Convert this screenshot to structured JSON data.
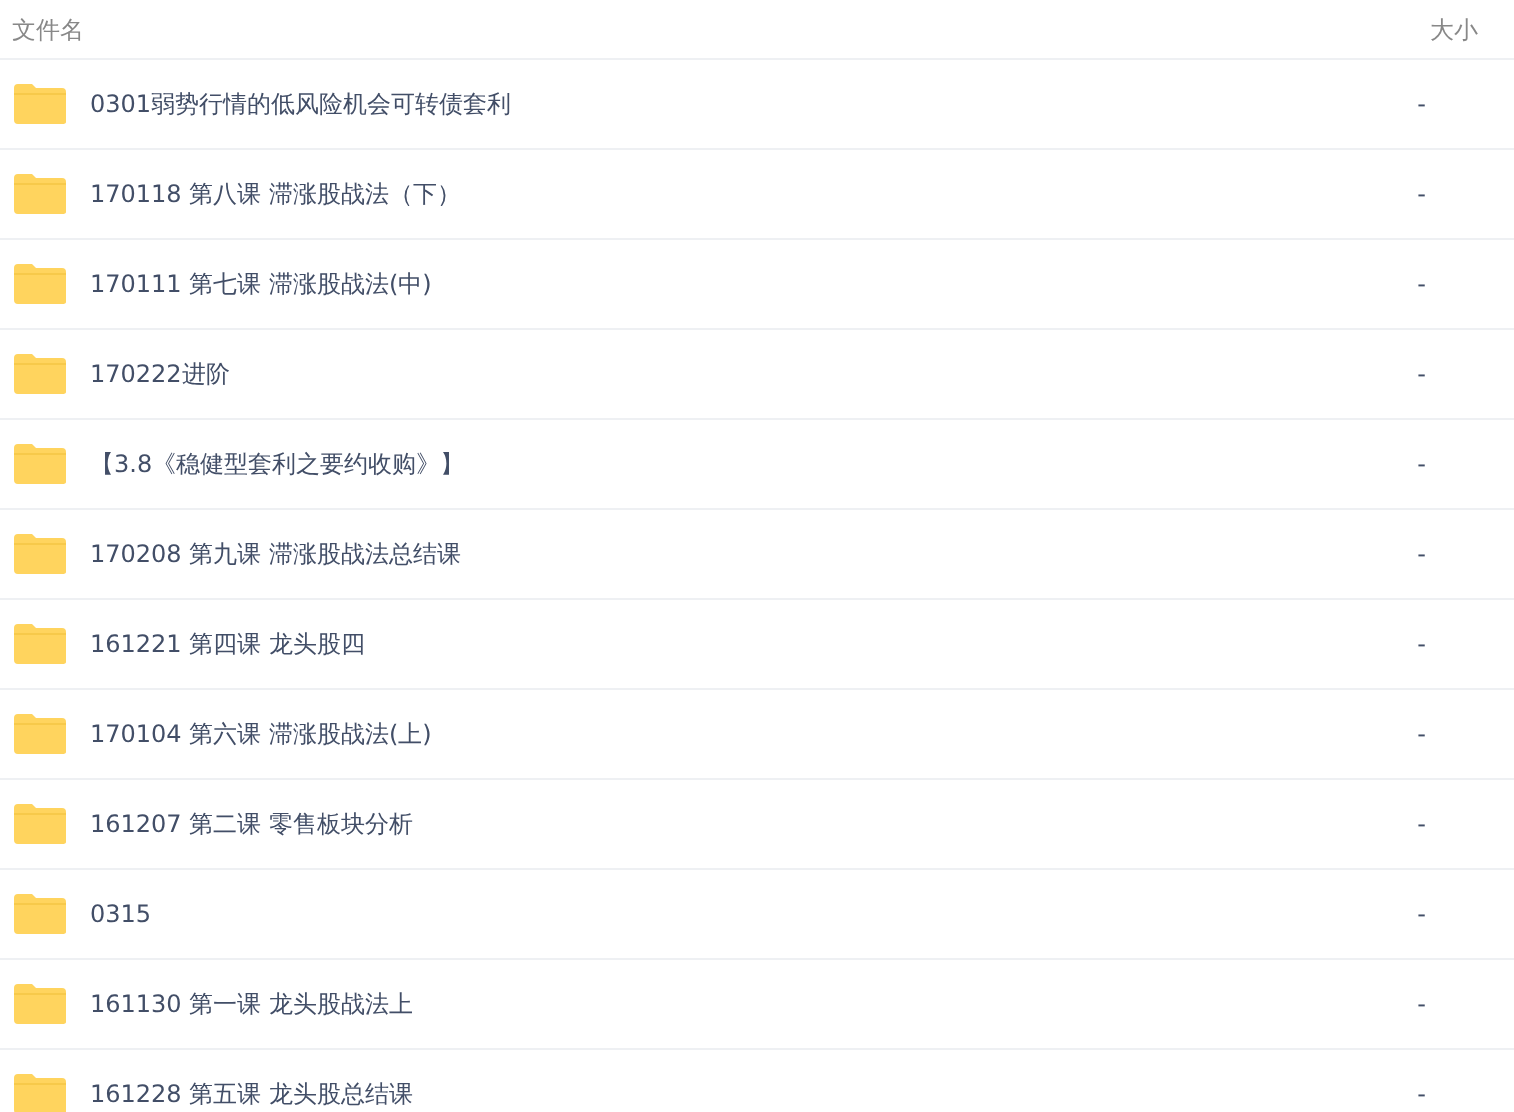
{
  "columns": [
    "文件名",
    "大小"
  ],
  "rows": [
    {
      "name": "0301弱势行情的低风险机会可转债套利",
      "size": "-"
    },
    {
      "name": "170118 第八课 滞涨股战法（下）",
      "size": "-"
    },
    {
      "name": "170111 第七课 滞涨股战法(中)",
      "size": "-"
    },
    {
      "name": "170222进阶",
      "size": "-"
    },
    {
      "name": "【3.8《稳健型套利之要约收购》】",
      "size": "-"
    },
    {
      "name": "170208 第九课 滞涨股战法总结课",
      "size": "-"
    },
    {
      "name": "161221 第四课 龙头股四",
      "size": "-"
    },
    {
      "name": "170104 第六课 滞涨股战法(上)",
      "size": "-"
    },
    {
      "name": "161207 第二课 零售板块分析",
      "size": "-"
    },
    {
      "name": "0315",
      "size": "-"
    },
    {
      "name": "161130 第一课 龙头股战法上",
      "size": "-"
    },
    {
      "name": "161228 第五课 龙头股总结课",
      "size": "-"
    }
  ]
}
